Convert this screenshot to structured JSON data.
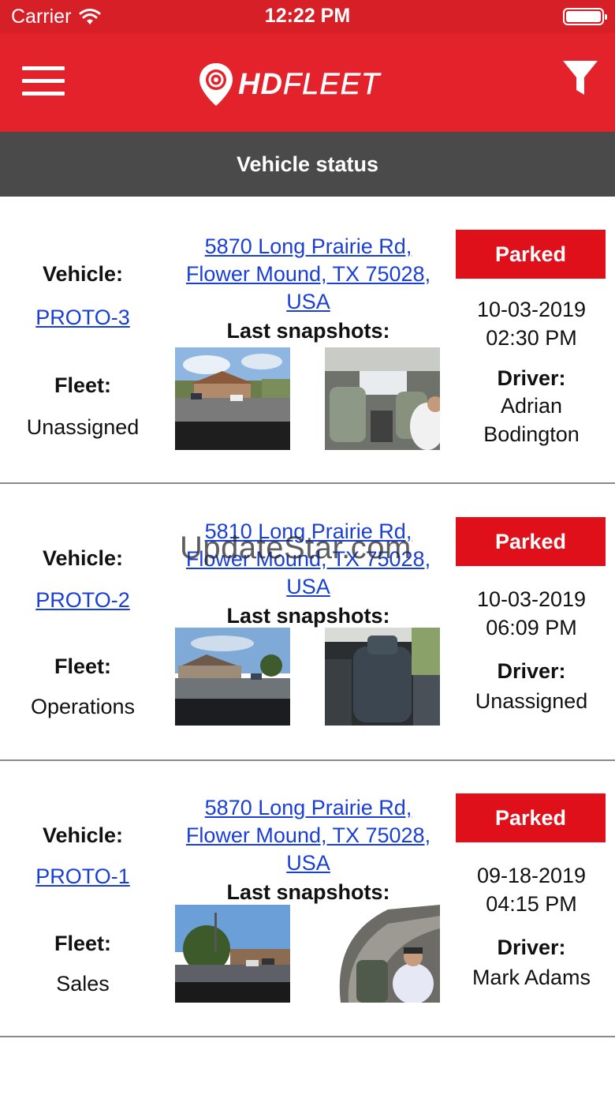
{
  "status_bar": {
    "carrier": "Carrier",
    "time": "12:22 PM"
  },
  "nav": {
    "logo_hd": "HD",
    "logo_fleet": "FLEET",
    "accent": "#e3222b"
  },
  "section": {
    "title": "Vehicle status"
  },
  "labels": {
    "vehicle": "Vehicle:",
    "fleet": "Fleet:",
    "last_snapshots": "Last snapshots:",
    "driver": "Driver:"
  },
  "vehicles": [
    {
      "vehicle": "PROTO-3",
      "fleet": "Unassigned",
      "address": [
        "5870 Long Prairie Rd,",
        "Flower Mound, TX 75028,",
        "USA"
      ],
      "status": "Parked",
      "date": "10-03-2019",
      "time": "02:30 PM",
      "driver": [
        "Adrian",
        "Bodington"
      ]
    },
    {
      "vehicle": "PROTO-2",
      "fleet": "Operations",
      "address": [
        "5810 Long Prairie Rd,",
        "Flower Mound, TX 75028,",
        "USA"
      ],
      "status": "Parked",
      "date": "10-03-2019",
      "time": "06:09 PM",
      "driver": [
        "Unassigned"
      ]
    },
    {
      "vehicle": "PROTO-1",
      "fleet": "Sales",
      "address": [
        "5870 Long Prairie Rd,",
        "Flower Mound, TX 75028,",
        "USA"
      ],
      "status": "Parked",
      "date": "09-18-2019",
      "time": "04:15 PM",
      "driver": [
        "Mark Adams"
      ]
    }
  ],
  "watermark": "UpdateStar.com"
}
